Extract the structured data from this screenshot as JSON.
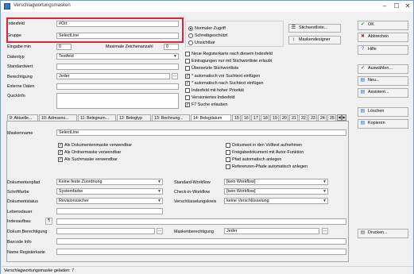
{
  "window": {
    "title": "Verschlagwortungsmasken",
    "minimize": "–",
    "maximize": "☐",
    "close": "✕"
  },
  "top": {
    "indexfeld_label": "Indexfeld",
    "indexfeld_value": "#Ort",
    "gruppe_label": "Gruppe",
    "gruppe_value": "SelectLine",
    "eingabe_min_label": "Eingabe min",
    "eingabe_min_value": "0",
    "max_zeichen_label": "Maximale Zeichenanzahl",
    "max_zeichen_value": "0",
    "datentyp_label": "Datentyp",
    "datentyp_value": "Textfeld",
    "standardwert_label": "Standardwert",
    "standardwert_value": "",
    "berechtigung_label": "Berechtigung",
    "berechtigung_value": "Jeder",
    "externe_daten_label": "Externe Daten",
    "externe_daten_value": "",
    "quickinfo_label": "QuickInfo"
  },
  "access": {
    "options": [
      "Normaler Zugriff",
      "Schreibgeschützt",
      "Unsichtbar"
    ],
    "selected": 0
  },
  "mid_buttons": {
    "stichwortliste": "Stichwortliste...",
    "maskendesigner": "Maskendesigner"
  },
  "field_options": [
    {
      "label": "Neue Registerkarte nach diesem Indexfeld",
      "checked": false
    },
    {
      "label": "Eintragungen nur mit Stichwortliste erlaubt",
      "checked": false
    },
    {
      "label": "Übersetzte Stichwortliste",
      "checked": false
    },
    {
      "label": "* automatisch vor Suchtext einfügen",
      "checked": true
    },
    {
      "label": "* automatisch nach Suchtext einfügen",
      "checked": true
    },
    {
      "label": "Indexfeld mit hoher Priorität",
      "checked": false
    },
    {
      "label": "Versioniertes Indexfeld",
      "checked": false
    },
    {
      "label": "F7 Suche erlauben",
      "checked": true
    }
  ],
  "side_buttons": [
    {
      "label": "OK",
      "icon": "check-icon",
      "glyph": "✔",
      "color": "#2e9a2e"
    },
    {
      "label": "Abbrechen",
      "icon": "cancel-icon",
      "glyph": "✖",
      "color": "#d02020"
    },
    {
      "label": "Hilfe",
      "icon": "help-icon",
      "glyph": "?",
      "color": "#2a66c2"
    },
    {
      "label": "Auswählen...",
      "icon": "select-icon",
      "glyph": "✔",
      "color": "#2e9a2e"
    },
    {
      "label": "Neu...",
      "icon": "new-icon",
      "glyph": "▤",
      "color": "#2a66c2"
    },
    {
      "label": "Assistent...",
      "icon": "wizard-icon",
      "glyph": "▤",
      "color": "#2a66c2"
    },
    {
      "label": "Löschen",
      "icon": "delete-icon",
      "glyph": "▤",
      "color": "#2a66c2"
    },
    {
      "label": "Kopieren",
      "icon": "copy-icon",
      "glyph": "▤",
      "color": "#2a66c2"
    },
    {
      "label": "Drucken...",
      "icon": "print-icon",
      "glyph": "▤",
      "color": "#555555"
    }
  ],
  "tabs": [
    "9: Aktuelle...",
    "10: Adressnu...",
    "11: Belegnum...",
    "12: Belegtyp",
    "13: Rechnung...",
    "14: Belegdatum",
    "15",
    "16",
    "17",
    "18",
    "19",
    "20",
    "21",
    "22",
    "23",
    "24",
    "25"
  ],
  "bottom": {
    "maskenname_label": "Maskenname",
    "maskenname_value": "SelectLine",
    "mask_options": [
      {
        "label": "Als Dokumentenmaske verwendbar",
        "checked": true
      },
      {
        "label": "Als Ordnermaske verwendbar",
        "checked": true
      },
      {
        "label": "Als Suchmaske verwendbar",
        "checked": true
      }
    ],
    "doc_options": [
      {
        "label": "Dokument in den Volltext aufnehmen",
        "checked": false
      },
      {
        "label": "Freigabedokument mit Autor-Funktion",
        "checked": false
      },
      {
        "label": "Pfad automatisch anlegen",
        "checked": false
      },
      {
        "label": "Referenzen-Pfade automatisch anlegen",
        "checked": false
      }
    ],
    "dokumentenpfad_label": "Dokumentenpfad",
    "dokumentenpfad_value": "Keine feste Zuordnung",
    "schriftfarbe_label": "Schriftfarbe",
    "schriftfarbe_value": "Systemfarbe",
    "dokumentstatus_label": "Dokumentstatus",
    "dokumentstatus_value": "Revisionssicher",
    "lebensdauer_label": "Lebensdauer",
    "lebensdauer_value": "",
    "indexaufbau_label": "Indexaufbau",
    "indexaufbau_btn": "¶",
    "indexaufbau_value": "",
    "standard_workflow_label": "Standard-Workflow",
    "standard_workflow_value": "[kein Workflow]",
    "checkin_workflow_label": "Check-in-Workflow",
    "checkin_workflow_value": "[kein Workflow]",
    "verschluesselung_label": "Verschlüsselungskreis",
    "verschluesselung_value": "keine Verschlüsselung",
    "dokum_berechtigung_label": "Dokum.Berechtigung",
    "dokum_berechtigung_value": "",
    "maskenberechtigung_label": "Maskenberechtigung",
    "maskenberechtigung_value": "Jeder",
    "barcode_label": "Barcode Info",
    "barcode_value": "",
    "registerkarte_label": "Name Registerkarte",
    "registerkarte_value": ""
  },
  "status": {
    "text": "Verschlagwortungsmaske geladen: 7"
  }
}
